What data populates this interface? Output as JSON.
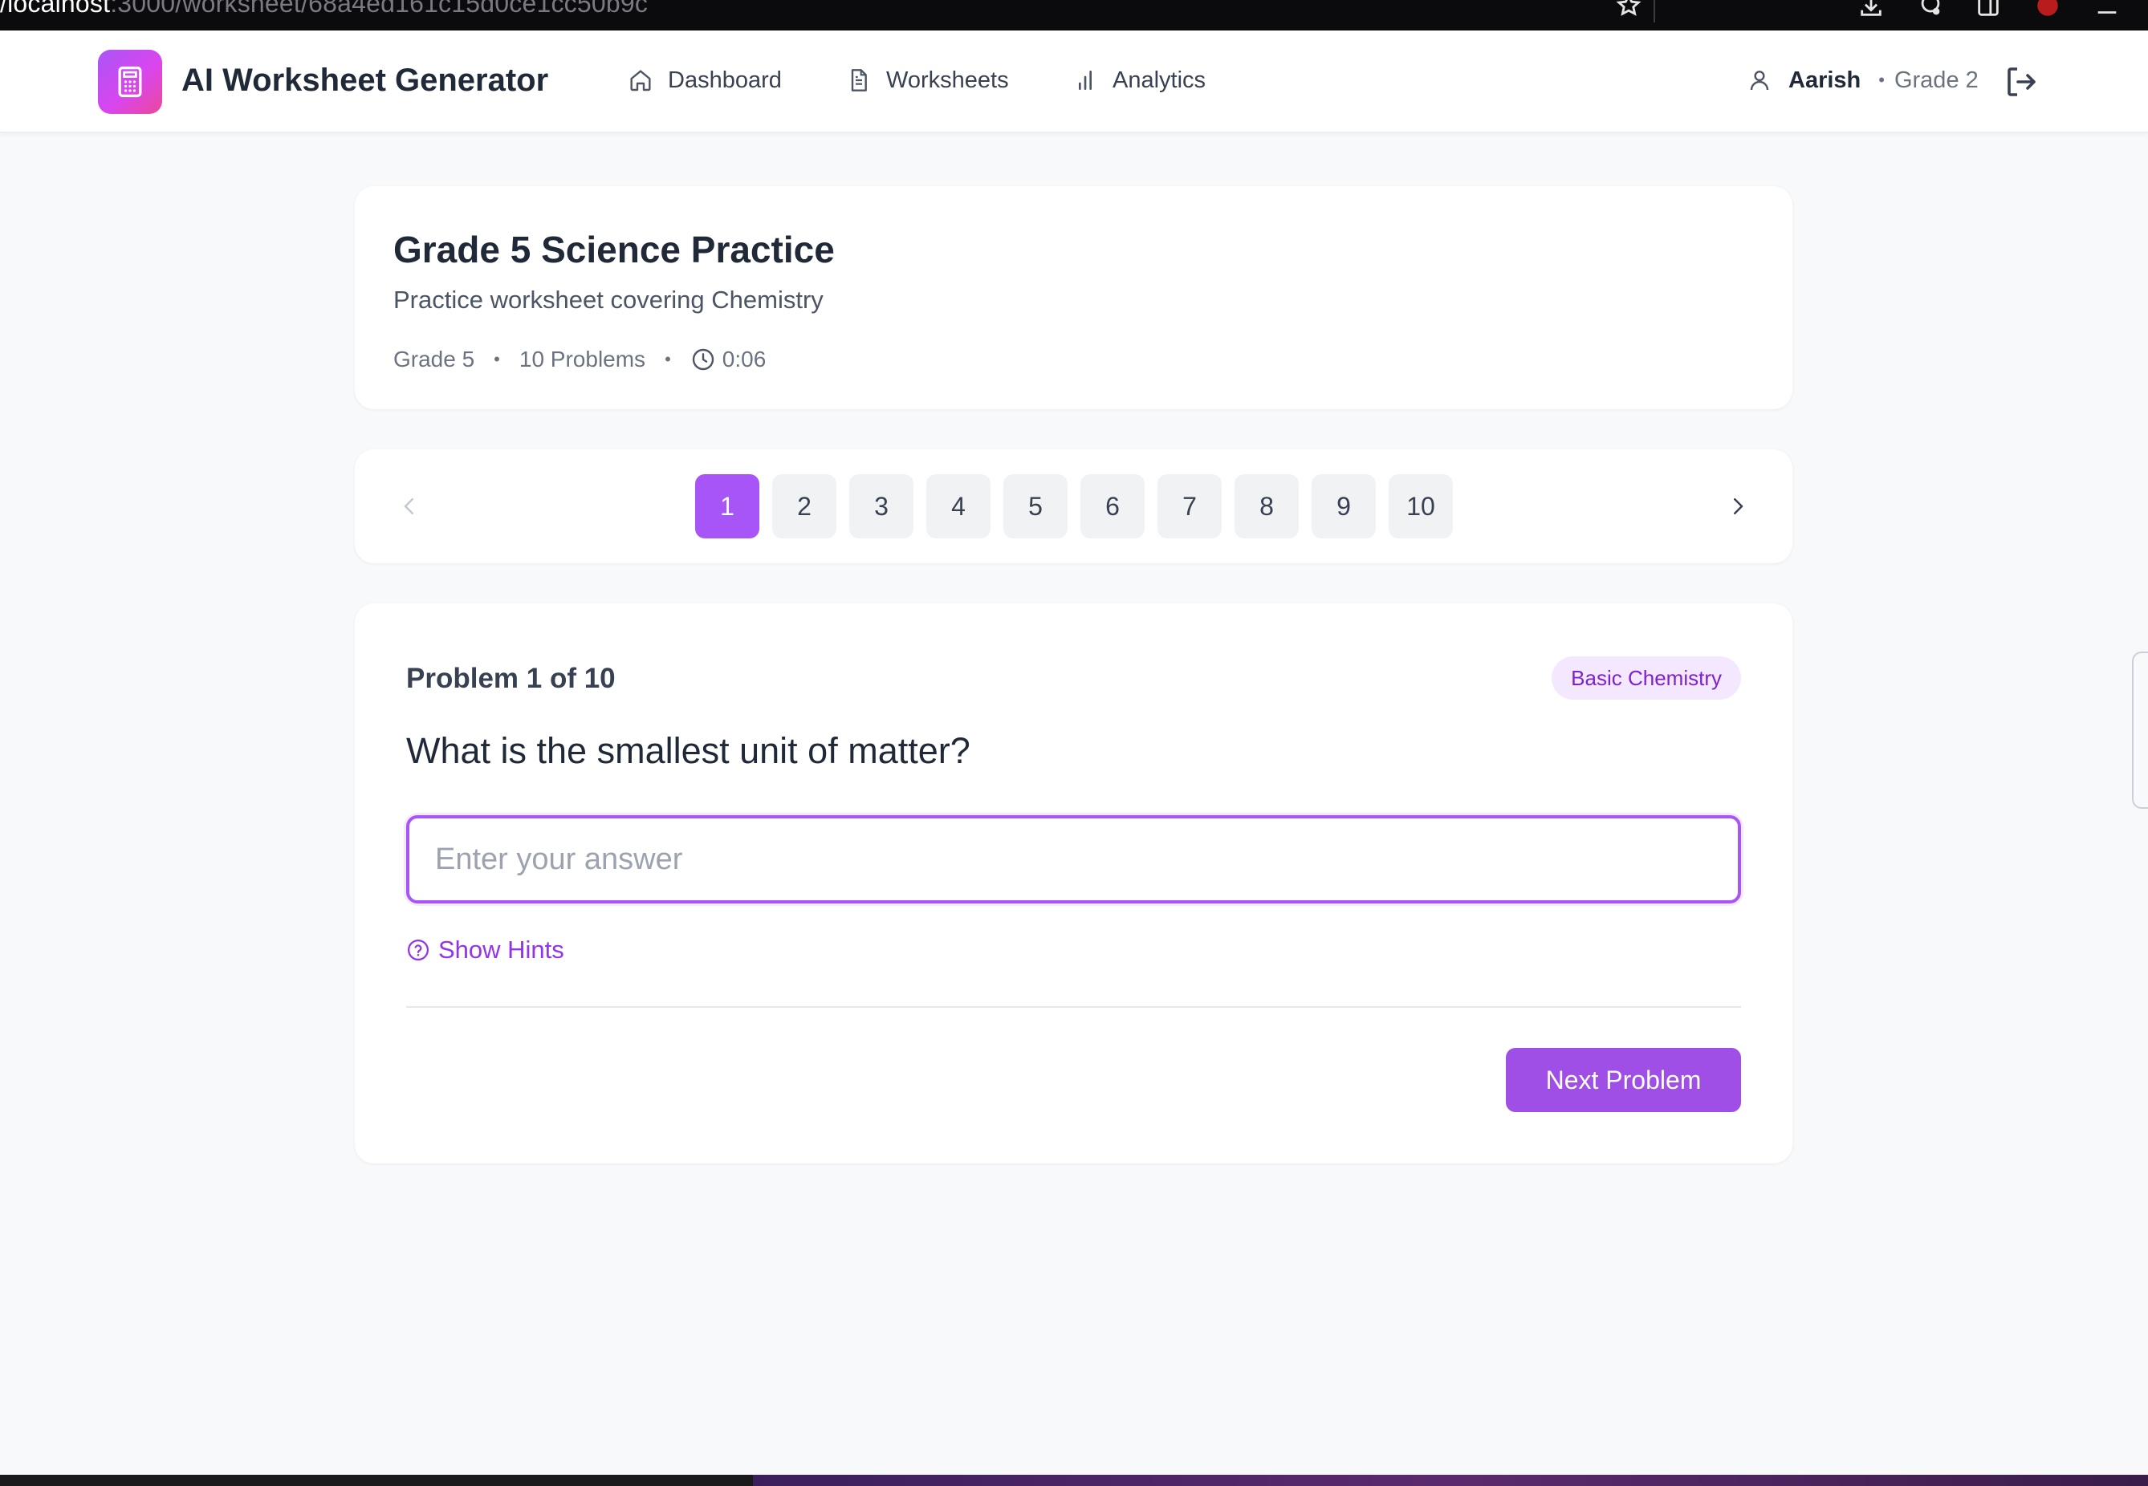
{
  "browser": {
    "url_host": "/localhost",
    "url_rest": ":3000/worksheet/68a4ed161c15d0ce1cc50b9c"
  },
  "header": {
    "app_title": "AI Worksheet Generator",
    "logo_icon": "calculator-icon",
    "nav": [
      {
        "label": "Dashboard",
        "icon": "home-icon"
      },
      {
        "label": "Worksheets",
        "icon": "document-icon"
      },
      {
        "label": "Analytics",
        "icon": "bar-chart-icon"
      }
    ],
    "user": {
      "name": "Aarish",
      "separator": "•",
      "grade": "Grade 2"
    }
  },
  "worksheet": {
    "title": "Grade 5 Science Practice",
    "description": "Practice worksheet covering Chemistry",
    "grade": "Grade 5",
    "separator": "•",
    "problem_count": "10 Problems",
    "timer": "0:06"
  },
  "pager": {
    "pages": [
      "1",
      "2",
      "3",
      "4",
      "5",
      "6",
      "7",
      "8",
      "9",
      "10"
    ],
    "active_page": "1"
  },
  "problem": {
    "label": "Problem 1 of 10",
    "topic_badge": "Basic Chemistry",
    "question": "What is the smallest unit of matter?",
    "answer_value": "",
    "answer_placeholder": "Enter your answer",
    "hints_label": "Show Hints",
    "next_label": "Next Problem"
  },
  "colors": {
    "accent": "#a855f7",
    "accent_dark": "#9333ea",
    "badge_bg": "#f3e8ff",
    "page_bg": "#f8f9fb"
  }
}
